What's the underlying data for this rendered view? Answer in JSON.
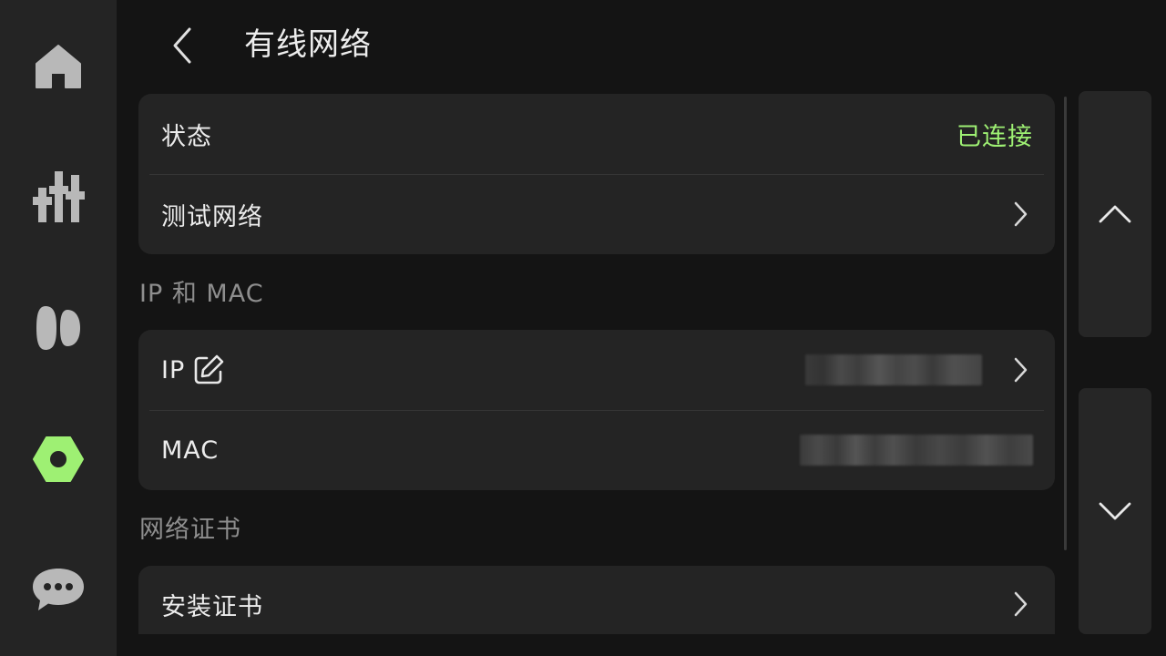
{
  "nav": {
    "items": [
      {
        "icon": "home-icon",
        "active": false
      },
      {
        "icon": "sliders-icon",
        "active": false
      },
      {
        "icon": "headphones-icon",
        "active": false
      },
      {
        "icon": "settings-hex-icon",
        "active": true
      },
      {
        "icon": "chat-bubble-icon",
        "active": false
      }
    ],
    "active_color": "#9ef073",
    "inactive_color": "#b8b8b8"
  },
  "header": {
    "title": "有线网络",
    "back_icon": "chevron-left-icon"
  },
  "status_card": {
    "status_label": "状态",
    "status_value": "已连接",
    "status_color": "#9ef073",
    "test_label": "测试网络"
  },
  "ip_mac_section": {
    "title": "IP 和 MAC",
    "ip_label": "IP",
    "ip_edit_icon": "edit-icon",
    "mac_label": "MAC"
  },
  "cert_section": {
    "title": "网络证书",
    "install_label": "安装证书"
  },
  "scroll_buttons": {
    "up_icon": "chevron-up-icon",
    "down_icon": "chevron-down-icon"
  }
}
